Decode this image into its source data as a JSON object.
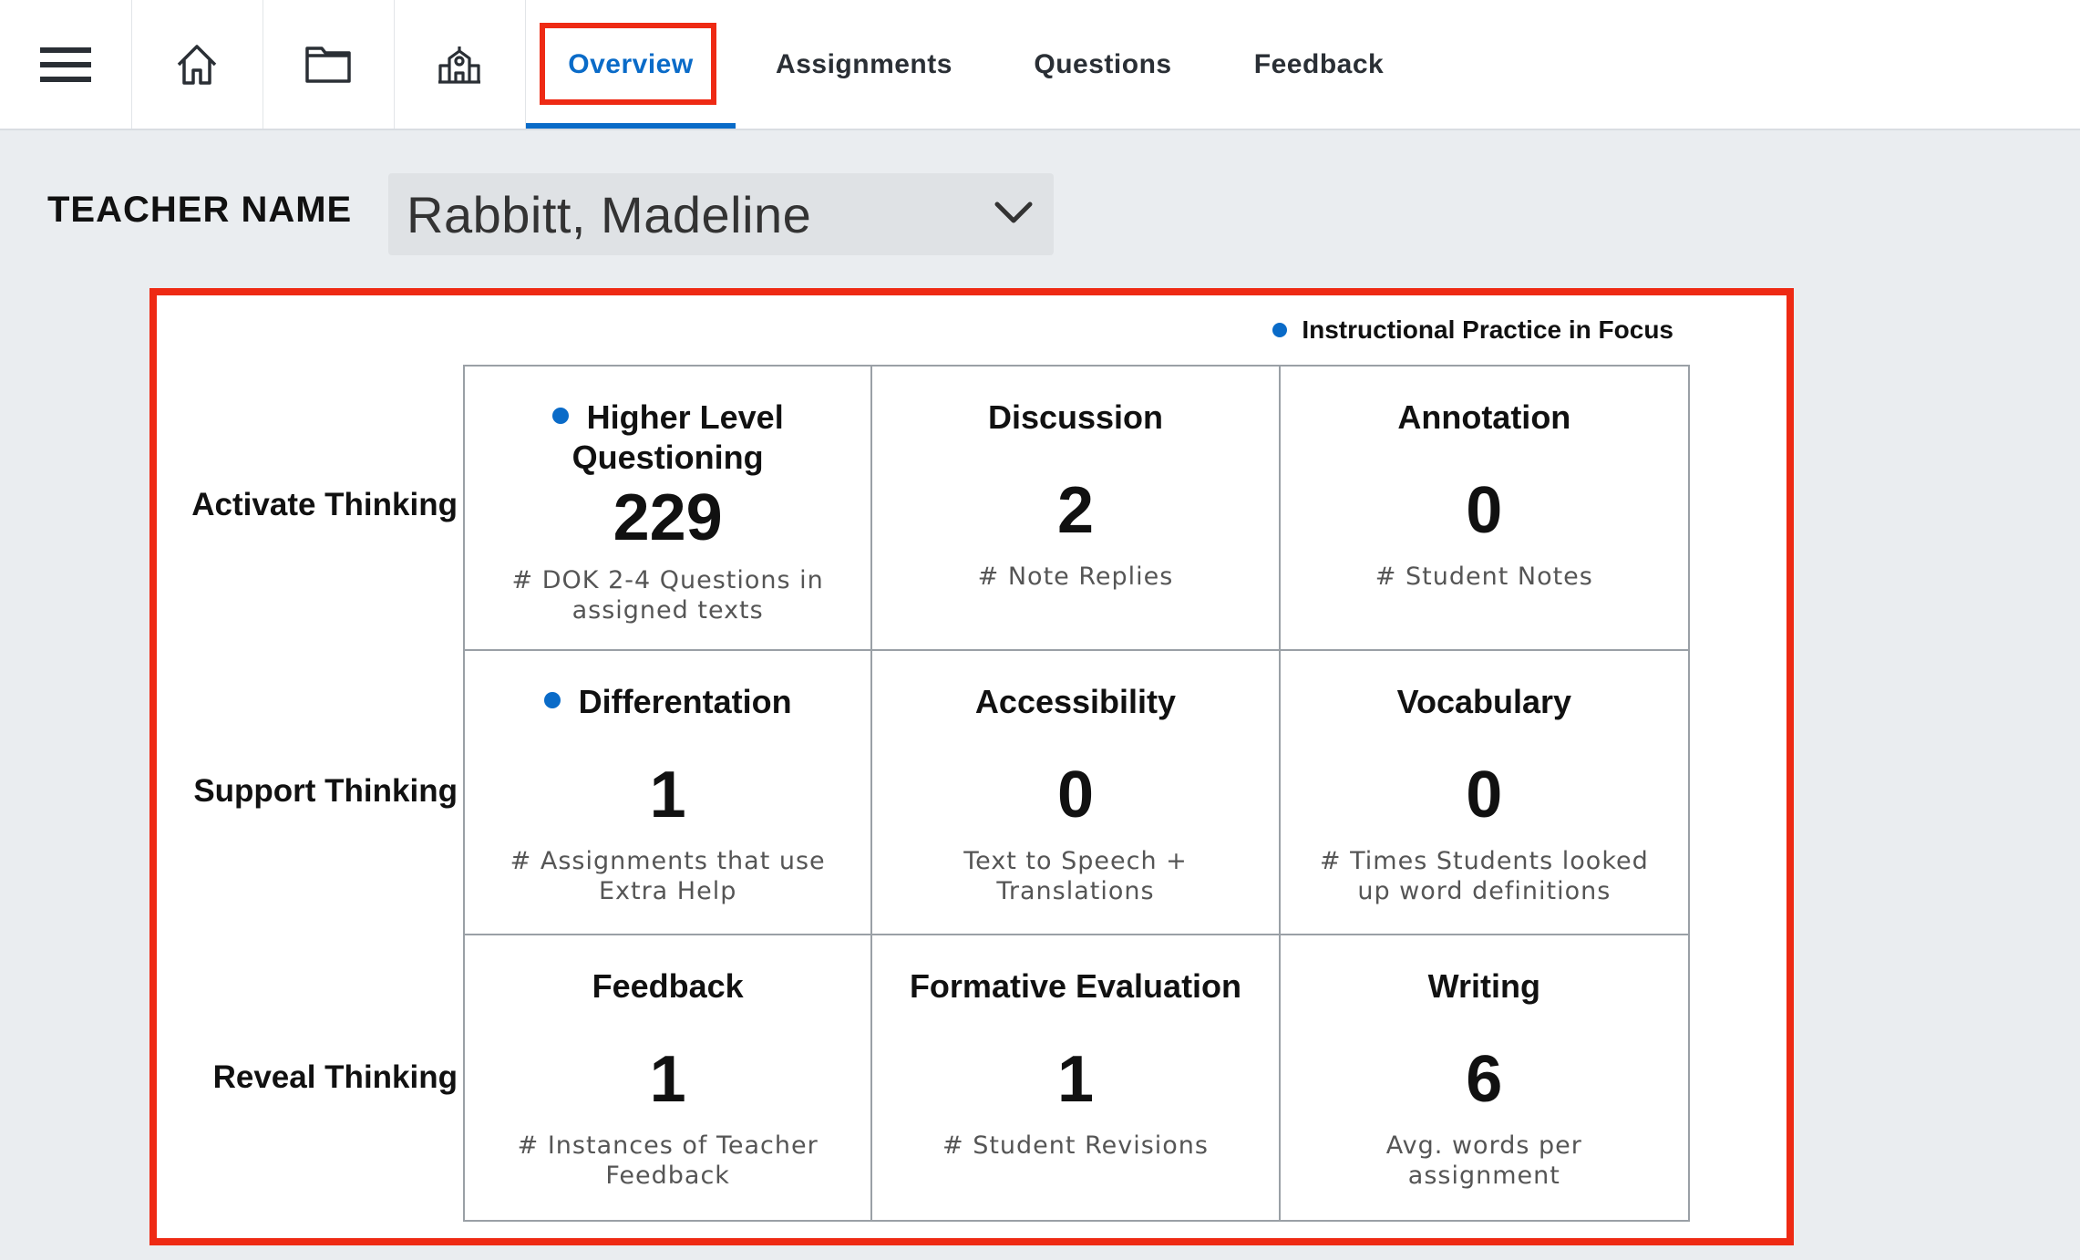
{
  "nav": {
    "icons": [
      "menu-icon",
      "home-icon",
      "folder-icon",
      "school-icon"
    ],
    "tabs": [
      {
        "label": "Overview",
        "active": true
      },
      {
        "label": "Assignments",
        "active": false
      },
      {
        "label": "Questions",
        "active": false
      },
      {
        "label": "Feedback",
        "active": false
      }
    ]
  },
  "teacher": {
    "label": "TEACHER NAME",
    "selected": "Rabbitt, Madeline"
  },
  "panel": {
    "legend": "Instructional Practice in Focus",
    "rows": [
      {
        "label": "Activate Thinking"
      },
      {
        "label": "Support Thinking"
      },
      {
        "label": "Reveal Thinking"
      }
    ],
    "cells": [
      {
        "title": "Higher Level Questioning",
        "value": "229",
        "caption": "# DOK 2-4 Questions in assigned texts",
        "focus": true
      },
      {
        "title": "Discussion",
        "value": "2",
        "caption": "# Note Replies",
        "focus": false
      },
      {
        "title": "Annotation",
        "value": "0",
        "caption": "# Student Notes",
        "focus": false
      },
      {
        "title": "Differentation",
        "value": "1",
        "caption": "# Assignments that use Extra Help",
        "focus": true
      },
      {
        "title": "Accessibility",
        "value": "0",
        "caption": "Text to Speech + Translations",
        "focus": false
      },
      {
        "title": "Vocabulary",
        "value": "0",
        "caption": "# Times Students looked up word definitions",
        "focus": false
      },
      {
        "title": "Feedback",
        "value": "1",
        "caption": "# Instances of Teacher Feedback",
        "focus": false
      },
      {
        "title": "Formative Evaluation",
        "value": "1",
        "caption": "# Student Revisions",
        "focus": false
      },
      {
        "title": "Writing",
        "value": "6",
        "caption": "Avg. words per assignment",
        "focus": false
      }
    ]
  },
  "colors": {
    "accent": "#0a6bc8",
    "highlight": "#ee2a14"
  }
}
